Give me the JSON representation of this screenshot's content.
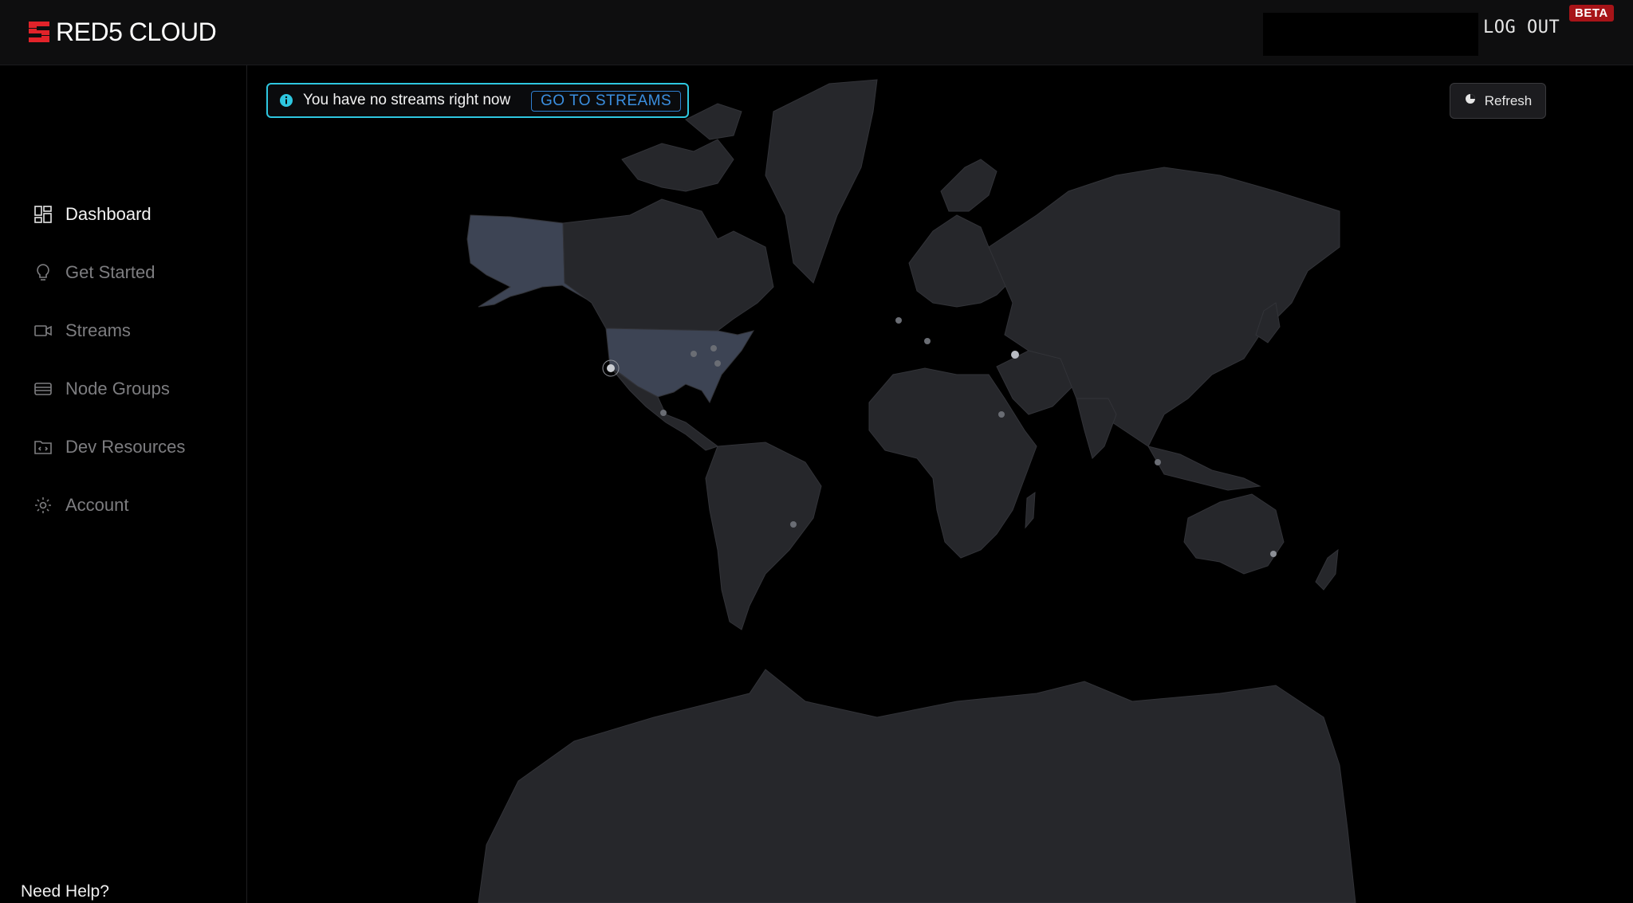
{
  "header": {
    "brand": "RED5 CLOUD",
    "logout_label": "LOG OUT",
    "badge": "BETA"
  },
  "sidebar": {
    "items": [
      {
        "label": "Dashboard",
        "icon": "dashboard-grid-icon",
        "active": true
      },
      {
        "label": "Get Started",
        "icon": "lightbulb-icon",
        "active": false
      },
      {
        "label": "Streams",
        "icon": "video-camera-icon",
        "active": false
      },
      {
        "label": "Node Groups",
        "icon": "server-stack-icon",
        "active": false
      },
      {
        "label": "Dev Resources",
        "icon": "code-folder-icon",
        "active": false
      },
      {
        "label": "Account",
        "icon": "gear-icon",
        "active": false
      }
    ],
    "help_label": "Need Help?",
    "collapse_icon": "collapse-left-icon"
  },
  "notice": {
    "message": "You have no streams right now",
    "action_label": "GO TO STREAMS",
    "icon": "info-icon"
  },
  "refresh": {
    "label": "Refresh",
    "icon": "refresh-icon"
  },
  "colors": {
    "brand_red": "#e2232a",
    "beta_bg": "#a71418",
    "accent_cyan": "#2ec7e0",
    "accent_blue": "#3b8fe0",
    "land": "#26272b",
    "highlighted_land": "#3d4454"
  }
}
